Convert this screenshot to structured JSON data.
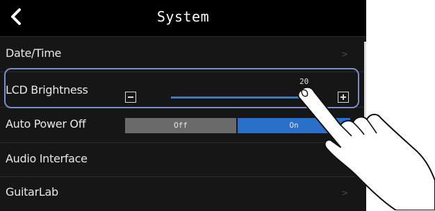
{
  "header": {
    "title": "System",
    "back_icon": "chevron-left-icon"
  },
  "rows": [
    {
      "label": "Date/Time",
      "arrow": ">"
    },
    {
      "label": "LCD Brightness",
      "value": "20",
      "level": 1.0
    },
    {
      "label": "Auto Power Off",
      "options": [
        "Off",
        "On"
      ],
      "selected": "On"
    },
    {
      "label": "Audio Interface"
    },
    {
      "label": "GuitarLab",
      "arrow": ">"
    }
  ],
  "colors": {
    "accent": "#2a6fc9",
    "highlight": "#7a8ec8",
    "background": "#000000"
  }
}
